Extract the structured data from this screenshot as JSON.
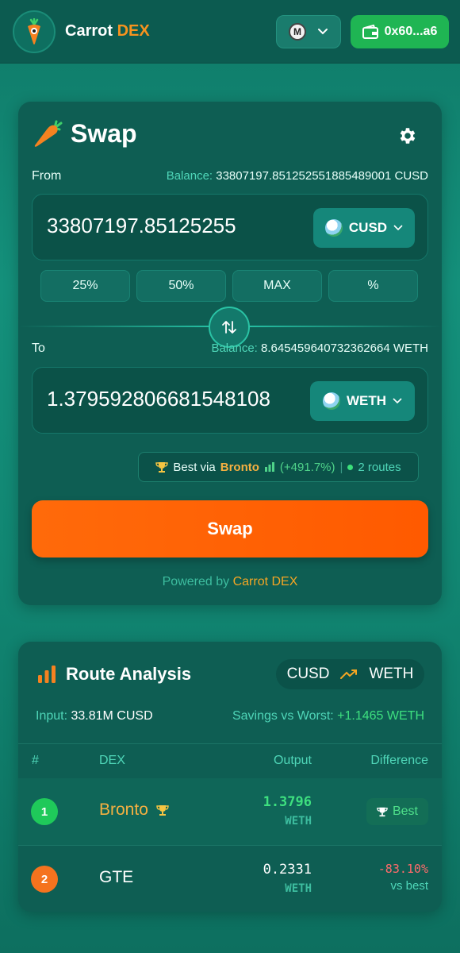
{
  "header": {
    "brand_main": "Carrot",
    "brand_accent": "DEX",
    "network_icon": "M",
    "wallet_address": "0x60...a6"
  },
  "swap": {
    "title": "Swap",
    "from": {
      "label": "From",
      "balance_key": "Balance:",
      "balance_value": "33807197.851252551885489001 CUSD",
      "amount": "33807197.85125255",
      "token": "CUSD"
    },
    "percent_buttons": [
      "25%",
      "50%",
      "MAX",
      "%"
    ],
    "to": {
      "label": "To",
      "balance_key": "Balance:",
      "balance_value": "8.645459640732362664 WETH",
      "amount": "1.379592806681548108",
      "token": "WETH"
    },
    "best_route": {
      "prefix": "Best via",
      "dex": "Bronto",
      "gain": "(+491.7%)",
      "routes": "2 routes"
    },
    "swap_button": "Swap",
    "powered_prefix": "Powered by",
    "powered_brand": "Carrot DEX"
  },
  "route_analysis": {
    "title": "Route Analysis",
    "pair_from": "CUSD",
    "pair_to": "WETH",
    "input_key": "Input:",
    "input_value": "33.81M CUSD",
    "savings_key": "Savings vs Worst:",
    "savings_value": "+1.1465 WETH",
    "columns": [
      "#",
      "DEX",
      "Output",
      "Difference"
    ],
    "rows": [
      {
        "rank": "1",
        "dex": "Bronto",
        "output": "1.3796",
        "unit": "WETH",
        "diff_badge": "Best"
      },
      {
        "rank": "2",
        "dex": "GTE",
        "output": "0.2331",
        "unit": "WETH",
        "diff": "-83.10%",
        "diff_sub": "vs best"
      }
    ]
  },
  "colors": {
    "accent_orange": "#ff6a0a",
    "wallet_green": "#1fb553",
    "brand_accent": "#f7931e",
    "teal_text": "#4fd6b8"
  }
}
